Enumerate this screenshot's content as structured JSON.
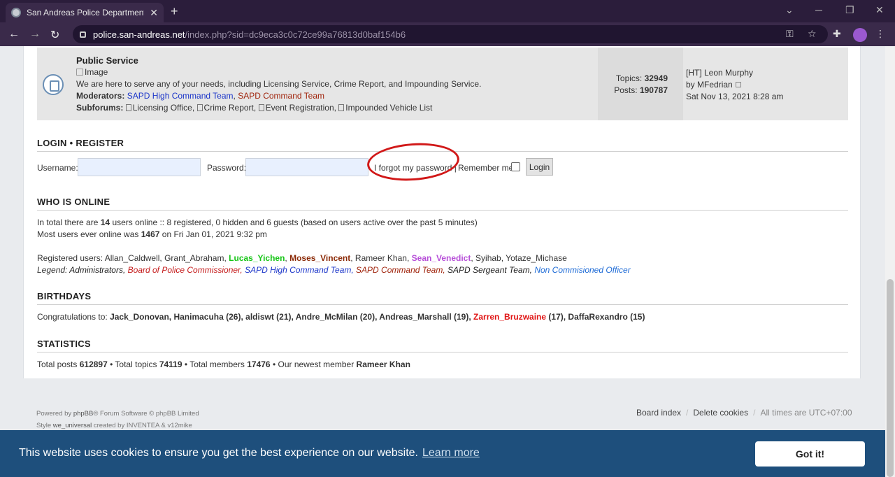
{
  "browser": {
    "tab_title": "San Andreas Police Department -",
    "tab_close": "✕",
    "new_tab": "+",
    "url_host": "police.san-andreas.net",
    "url_path": "/index.php?sid=dc9eca3c0c72ce99a76813d0baf154b6"
  },
  "forum": {
    "title": "Public Service",
    "image_alt": "Image",
    "description": "We are here to serve any of your needs, including Licensing Service, Crime Report, and Impounding Service.",
    "moderators_label": "Moderators:",
    "moderators": [
      "SAPD High Command Team",
      "SAPD Command Team"
    ],
    "subforums_label": "Subforums:",
    "subforums": [
      "Licensing Office,",
      "Crime Report,",
      "Event Registration,",
      "Impounded Vehicle List"
    ],
    "topics_label": "Topics:",
    "topics": "32949",
    "posts_label": "Posts:",
    "posts": "190787",
    "last_post_title": "[HT] Leon Murphy",
    "last_post_by_label": "by",
    "last_post_by": "MFedrian",
    "last_post_date": "Sat Nov 13, 2021 8:28 am"
  },
  "login": {
    "heading_login": "LOGIN",
    "heading_sep": "•",
    "heading_register": "REGISTER",
    "username_label": "Username:",
    "password_label": "Password:",
    "forgot": "I forgot my password",
    "forgot_sep": "|",
    "remember": "Remember me",
    "button": "Login"
  },
  "online": {
    "heading": "WHO IS ONLINE",
    "line1_pre": "In total there are",
    "total": "14",
    "line1_post": "users online :: 8 registered, 0 hidden and 6 guests (based on users active over the past 5 minutes)",
    "line2_pre": "Most users ever online was",
    "max": "1467",
    "line2_post": "on Fri Jan 01, 2021 9:32 pm",
    "registered_label": "Registered users:",
    "users_a": "Allan_Caldwell, Grant_Abraham,",
    "user_green": "Lucas_Yichen",
    "user_brown": "Moses_Vincent",
    "user_mid": ", Rameer Khan,",
    "user_purple": "Sean_Venedict",
    "users_b": ", Syihab, Yotaze_Michase",
    "legend_label": "Legend:",
    "legend": [
      "Administrators,",
      "Board of Police Commissioner,",
      "SAPD High Command Team,",
      "SAPD Command Team,",
      "SAPD Sergeant Team,",
      "Non Commisioned Officer"
    ]
  },
  "birthdays": {
    "heading": "BIRTHDAYS",
    "label": "Congratulations to:",
    "list_a": "Jack_Donovan, Hanimacuha (26), aldiswt (21), Andre_McMilan (20), Andreas_Marshall (19),",
    "red_user": "Zarren_Bruzwaine",
    "list_b": "(17), DaffaRexandro (15)"
  },
  "statistics": {
    "heading": "STATISTICS",
    "posts_label": "Total posts",
    "posts": "612897",
    "topics_label": "• Total topics",
    "topics": "74119",
    "members_label": "• Total members",
    "members": "17476",
    "newest_label": "• Our newest member",
    "newest": "Rameer Khan"
  },
  "footer": {
    "powered_pre": "Powered by",
    "phpbb": "phpBB",
    "powered_post": "® Forum Software © phpBB Limited",
    "style_pre": "Style",
    "style_name": "we_universal",
    "style_post": "created by INVENTEA & v12mike",
    "board_index": "Board index",
    "delete_cookies": "Delete cookies",
    "timezone": "All times are UTC+07:00",
    "sep": "/"
  },
  "cookie": {
    "message": "This website uses cookies to ensure you get the best experience on our website.",
    "learn_more": "Learn more",
    "button": "Got it!"
  }
}
